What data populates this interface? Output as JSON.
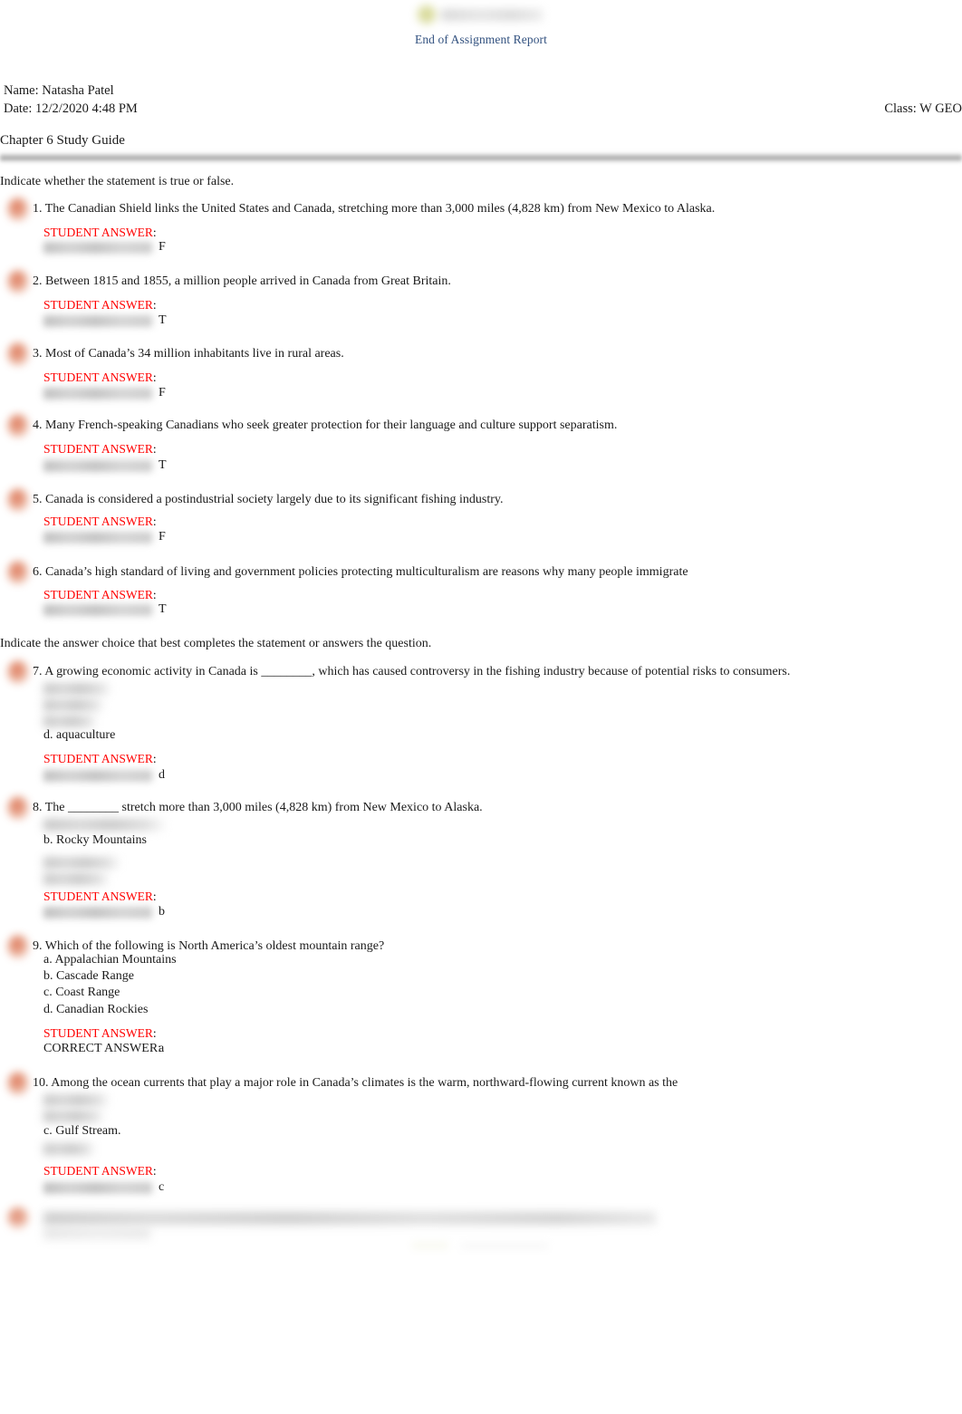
{
  "header": {
    "logo_icon": "cengage-logo-redacted",
    "report_title": "End of Assignment Report",
    "name_line": "Name: Natasha Patel",
    "date_line": "Date: 12/2/2020 4:48 PM",
    "class_line": "Class: W GEO",
    "chapter_title": "Chapter 6 Study Guide"
  },
  "sections": [
    {
      "instruction": "Indicate whether the statement is true or false."
    },
    {
      "instruction": "Indicate the answer choice that best completes the statement or answers the question."
    }
  ],
  "labels": {
    "student_answer": "STUDENT ANSWER",
    "colon": ":",
    "correct_answer": "CORRECT ANSWER:",
    "correct_answer_redacted": "correct-answer-label-redacted"
  },
  "questions": [
    {
      "number": "1.",
      "text": "1. The Canadian Shield links the United States and Canada, stretching more than 3,000 miles (4,828 km) from New Mexico to Alaska.",
      "options": [],
      "student_answer_label": "STUDENT ANSWER",
      "correct_label_visible": false,
      "correct_letter": "F"
    },
    {
      "number": "2.",
      "text": "2. Between 1815 and 1855, a million people arrived in Canada from Great Britain.",
      "options": [],
      "student_answer_label": "STUDENT ANSWER",
      "correct_label_visible": false,
      "correct_letter": "T"
    },
    {
      "number": "3.",
      "text": "3. Most of Canada’s 34 million inhabitants live in rural areas.",
      "options": [],
      "student_answer_label": "STUDENT ANSWER",
      "correct_label_visible": false,
      "correct_letter": "F"
    },
    {
      "number": "4.",
      "text": "4. Many French-speaking Canadians who seek greater protection for their language and culture support separatism.",
      "options": [],
      "student_answer_label": "STUDENT ANSWER",
      "correct_label_visible": false,
      "correct_letter": "T"
    },
    {
      "number": "5.",
      "text": "5. Canada is considered a postindustrial society largely due to its significant fishing industry.",
      "options": [],
      "student_answer_label": "STUDENT ANSWER",
      "correct_label_visible": false,
      "correct_letter": "F"
    },
    {
      "number": "6.",
      "text": "6. Canada’s high standard of living and government policies protecting multiculturalism are reasons why many people immigrate",
      "options": [],
      "student_answer_label": "STUDENT ANSWER",
      "correct_label_visible": false,
      "correct_letter": "T"
    },
    {
      "number": "7.",
      "text": "7. A growing economic activity in Canada is ________, which has caused controversy in the fishing industry because of potential risks to consumers.",
      "options": [
        {
          "label": "option-a-redacted",
          "visible": false
        },
        {
          "label": "option-b-redacted",
          "visible": false
        },
        {
          "label": "option-c-redacted",
          "visible": false
        },
        {
          "label": "d. aquaculture",
          "visible": true
        }
      ],
      "student_answer_label": "STUDENT ANSWER",
      "correct_label_visible": false,
      "correct_letter": "d"
    },
    {
      "number": "8.",
      "text": "8. The ________ stretch more than 3,000 miles (4,828 km) from New Mexico to Alaska.",
      "options": [
        {
          "label": "option-a-redacted",
          "visible": false
        },
        {
          "label": "b. Rocky Mountains",
          "visible": true
        },
        {
          "label": "option-c-redacted",
          "visible": false
        },
        {
          "label": "option-d-redacted",
          "visible": false
        }
      ],
      "student_answer_label": "STUDENT ANSWER",
      "correct_label_visible": false,
      "correct_letter": "b"
    },
    {
      "number": "9.",
      "text": "9. Which of the following is North America’s oldest mountain range?",
      "options": [
        {
          "label": "a. Appalachian Mountains",
          "visible": true
        },
        {
          "label": "b. Cascade Range",
          "visible": true
        },
        {
          "label": "c. Coast Range",
          "visible": true
        },
        {
          "label": "d. Canadian Rockies",
          "visible": true
        }
      ],
      "student_answer_label": "STUDENT ANSWER",
      "correct_label_visible": true,
      "correct_label_text": "CORRECT ANSWER:",
      "correct_letter": "a"
    },
    {
      "number": "10.",
      "text": "10. Among the ocean currents that play a major role in Canada’s climates is the warm, northward-flowing current known as the",
      "options": [
        {
          "label": "option-a-redacted",
          "visible": false
        },
        {
          "label": "option-b-redacted",
          "visible": false
        },
        {
          "label": "c. Gulf Stream.",
          "visible": true
        },
        {
          "label": "option-d-redacted",
          "visible": false
        }
      ],
      "student_answer_label": "STUDENT ANSWER",
      "correct_label_visible": false,
      "correct_letter": "c"
    }
  ],
  "tail": {
    "note": "question-11-faded-redacted"
  }
}
